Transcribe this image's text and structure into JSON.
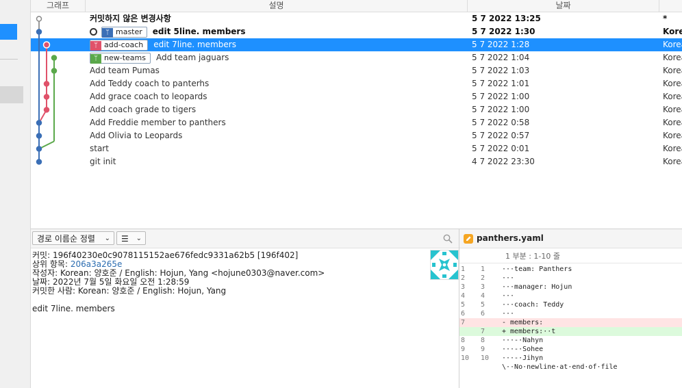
{
  "columns": {
    "graph": "그래프",
    "description": "설명",
    "date": "날짜"
  },
  "commits": [
    {
      "message": "커밋하지 않은 변경사항",
      "date": "5 7 2022 13:25",
      "author": "*"
    },
    {
      "branch": "master",
      "branch_color": "#3b6fb6",
      "head": true,
      "message": "edit 5line. members",
      "date": "5 7 2022 1:30",
      "author": "Korean",
      "bold": true
    },
    {
      "branch": "add-coach",
      "branch_color": "#e0526a",
      "message": "edit 7line. members",
      "date": "5 7 2022 1:28",
      "author": "Korean",
      "selected": true
    },
    {
      "branch": "new-teams",
      "branch_color": "#5aa84a",
      "message": "Add team jaguars",
      "date": "5 7 2022 1:04",
      "author": "Korean"
    },
    {
      "message": "Add team Pumas",
      "date": "5 7 2022 1:03",
      "author": "Korean"
    },
    {
      "message": "Add Teddy coach to panterhs",
      "date": "5 7 2022 1:01",
      "author": "Korean"
    },
    {
      "message": "Add grace coach to leopards",
      "date": "5 7 2022 1:00",
      "author": "Korean"
    },
    {
      "message": "Add coach grade to tigers",
      "date": "5 7 2022 1:00",
      "author": "Korean"
    },
    {
      "message": "Add Freddie member to panthers",
      "date": "5 7 2022 0:58",
      "author": "Korean"
    },
    {
      "message": "Add Olivia to Leopards",
      "date": "5 7 2022 0:57",
      "author": "Korean"
    },
    {
      "message": "start",
      "date": "5 7 2022 0:01",
      "author": "Korean"
    },
    {
      "message": "git init",
      "date": "4 7 2022 23:30",
      "author": "Korean"
    }
  ],
  "toolbar": {
    "sort_label": "경로 이름순 정렬",
    "view_icon": "list-icon",
    "search_icon": "search-icon"
  },
  "commit_detail": {
    "commit_label": "커밋:",
    "commit_value": "196f40230e0c9078115152ae676fedc9331a62b5 [196f402]",
    "parent_label": "상위 항목:",
    "parent_value": "206a3a265e",
    "author_label": "작성자:",
    "author_value": "Korean: 양호준 / English: Hojun, Yang <hojune0303@naver.com>",
    "date_label": "날짜:",
    "date_value": "2022년 7월 5일 화요일 오전 1:28:59",
    "committer_label": "커밋한 사람:",
    "committer_value": "Korean: 양호준 / English: Hojun, Yang",
    "message": "edit 7line. members"
  },
  "diff": {
    "file_icon": "pencil-file-icon",
    "filename": "panthers.yaml",
    "hunk": "1 부분 : 1-10 줄",
    "lines": [
      {
        "old": "1",
        "new": "1",
        "type": "ctx",
        "text": "···team: Panthers"
      },
      {
        "old": "2",
        "new": "2",
        "type": "ctx",
        "text": "···"
      },
      {
        "old": "3",
        "new": "3",
        "type": "ctx",
        "text": "···manager: Hojun"
      },
      {
        "old": "4",
        "new": "4",
        "type": "ctx",
        "text": "···"
      },
      {
        "old": "5",
        "new": "5",
        "type": "ctx",
        "text": "···coach: Teddy"
      },
      {
        "old": "6",
        "new": "6",
        "type": "ctx",
        "text": "···"
      },
      {
        "old": "7",
        "new": "",
        "type": "del",
        "text": "- members:"
      },
      {
        "old": "",
        "new": "7",
        "type": "add",
        "text": "+ members:··t"
      },
      {
        "old": "8",
        "new": "8",
        "type": "ctx",
        "text": "···-·Nahyn"
      },
      {
        "old": "9",
        "new": "9",
        "type": "ctx",
        "text": "···-·Sohee"
      },
      {
        "old": "10",
        "new": "10",
        "type": "ctx",
        "text": "···-·Jihyn"
      },
      {
        "old": "",
        "new": "",
        "type": "ctx",
        "text": "\\··No·newline·at·end·of·file"
      }
    ]
  },
  "colors": {
    "selection": "#1e90ff",
    "master": "#3b6fb6",
    "add_coach": "#e0526a",
    "new_teams": "#5aa84a"
  }
}
